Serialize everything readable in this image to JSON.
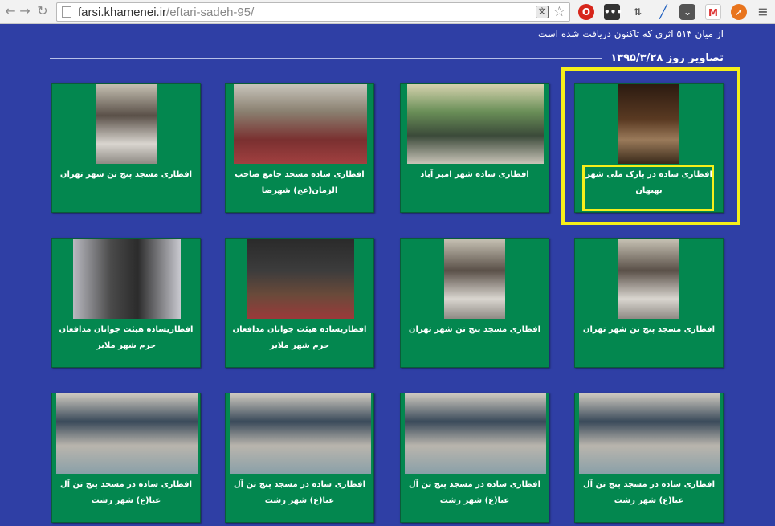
{
  "browser": {
    "url_host": "farsi.khamenei.ir",
    "url_path": "/eftari-sadeh-95/",
    "extensions": [
      "translate-icon",
      "opera-icon",
      "dots-icon",
      "download-icon",
      "pen-icon",
      "pocket-icon",
      "gmail-icon",
      "rocket-icon"
    ]
  },
  "page": {
    "header_text": "از میان ۵۱۴ اثری که تاکنون دریافت شده است",
    "date_title": "تصاویر روز ۱۳۹۵/۳/۲۸"
  },
  "colors": {
    "page_bg": "#2f3fa5",
    "card_bg": "#03874f",
    "highlight": "#f6ef1b"
  },
  "cards": [
    {
      "caption": "افطاری ساده در پارک ملی شهر بهبهان",
      "photo": "park-night-iftar"
    },
    {
      "caption": "افطاری ساده شهر امیر آباد",
      "photo": "hall-long-table"
    },
    {
      "caption": "افطاری ساده مسجد جامع صاحب الزمان(عج) شهرضا",
      "photo": "mosque-carpet"
    },
    {
      "caption": "افطاری مسجد پنج تن شهر تهران",
      "photo": "mosque-narrow"
    },
    {
      "caption": "افطاری مسجد پنج تن شهر تهران",
      "photo": "mosque-narrow"
    },
    {
      "caption": "افطاری مسجد پنج تن شهر تهران",
      "photo": "mosque-narrow"
    },
    {
      "caption": "افطاریساده هیئت جوانان مدافعان حرم شهر ملایر",
      "photo": "tent-gathering"
    },
    {
      "caption": "افطاریساده هیئت جوانان مدافعان حرم شهر ملایر",
      "photo": "alley-row"
    },
    {
      "caption": "افطاری ساده در مسجد پنج تن آل عبا(ع) شهر رشت",
      "photo": "mosque-rasht"
    },
    {
      "caption": "افطاری ساده در مسجد پنج تن آل عبا(ع) شهر رشت",
      "photo": "mosque-rasht"
    },
    {
      "caption": "افطاری ساده در مسجد پنج تن آل عبا(ع) شهر رشت",
      "photo": "mosque-rasht"
    },
    {
      "caption": "افطاری ساده در مسجد پنج تن آل عبا(ع) شهر رشت",
      "photo": "mosque-rasht"
    }
  ]
}
